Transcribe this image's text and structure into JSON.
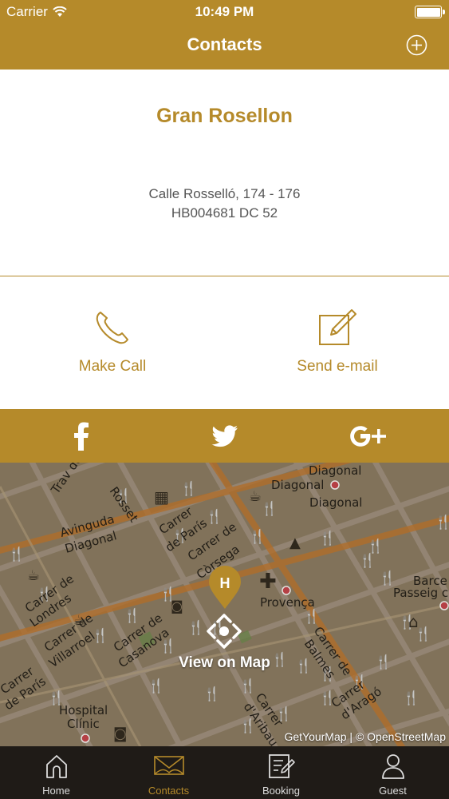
{
  "status_bar": {
    "carrier": "Carrier",
    "time": "10:49 PM"
  },
  "navbar": {
    "title": "Contacts",
    "add_icon": "plus-circle-icon"
  },
  "hotel": {
    "name": "Gran Rosellon",
    "address_line1": "Calle Rosselló, 174 - 176",
    "address_line2": "HB004681 DC 52"
  },
  "actions": {
    "call_label": "Make Call",
    "email_label": "Send e-mail"
  },
  "social": [
    "facebook-icon",
    "twitter-icon",
    "google-plus-icon"
  ],
  "map": {
    "view_label": "View on Map",
    "attribution": "GetYourMap | © OpenStreetMap",
    "street_labels": [
      "Diagonal",
      "Diagonal",
      "Diagonal",
      "Avinguda Diagonal",
      "Carrer de París",
      "Carrer de Còrsega",
      "Provença",
      "Barce Passeig c",
      "Carrer de Londres",
      "Carrer de Villarroel",
      "Carrer de Casanova",
      "Carrer de Balmes",
      "Carrer d'Aribau",
      "Carrer d'Aragó",
      "Carrer de París",
      "Hospital Clínic",
      "Trav de G",
      "Rosset"
    ]
  },
  "tabs": [
    {
      "label": "Home",
      "icon": "home-icon"
    },
    {
      "label": "Contacts",
      "icon": "envelope-icon",
      "active": true
    },
    {
      "label": "Booking",
      "icon": "booking-icon"
    },
    {
      "label": "Guest",
      "icon": "user-icon"
    }
  ],
  "colors": {
    "accent": "#b58a2a",
    "tabbar": "#1f1b17",
    "map": "#8a7b63"
  }
}
